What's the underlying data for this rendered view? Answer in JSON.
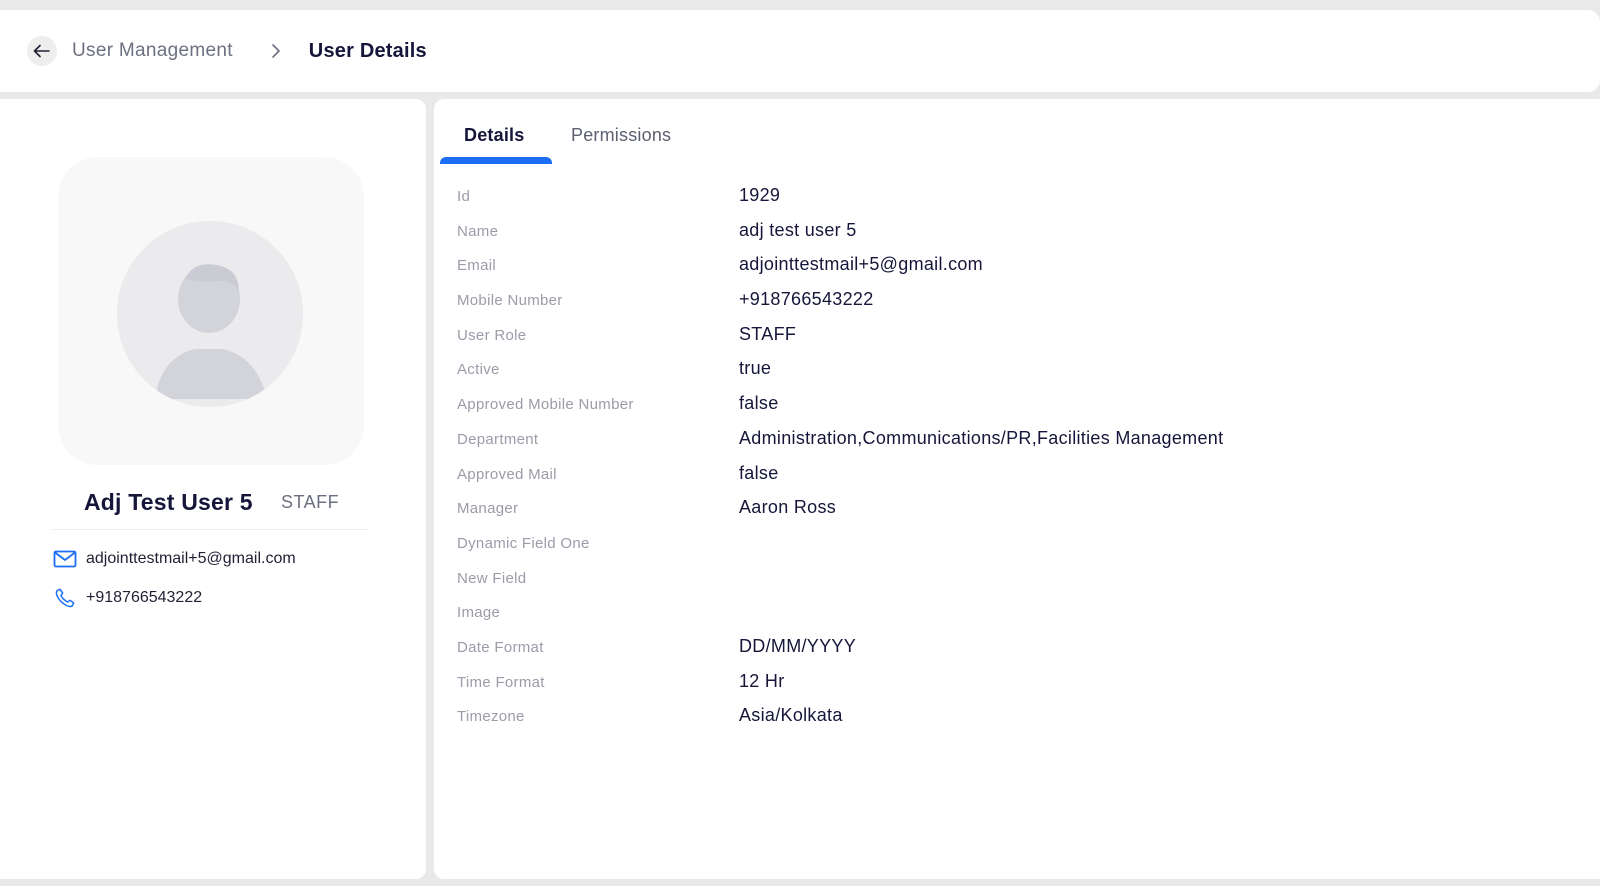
{
  "header": {
    "back_icon": "arrow-left-icon",
    "breadcrumb_parent": "User Management",
    "breadcrumb_separator_icon": "chevron-right-icon",
    "breadcrumb_current": "User Details"
  },
  "profile": {
    "avatar_icon": "user-placeholder-icon",
    "name": "Adj Test User 5",
    "role": "STAFF",
    "email_icon": "mail-icon",
    "email": "adjointtestmail+5@gmail.com",
    "phone_icon": "phone-icon",
    "phone": "+918766543222"
  },
  "tabs": [
    {
      "label": "Details",
      "active": true
    },
    {
      "label": "Permissions",
      "active": false
    }
  ],
  "details": [
    {
      "label": "Id",
      "value": "1929"
    },
    {
      "label": "Name",
      "value": "adj test user 5"
    },
    {
      "label": "Email",
      "value": "adjointtestmail+5@gmail.com"
    },
    {
      "label": "Mobile Number",
      "value": "+918766543222"
    },
    {
      "label": "User Role",
      "value": "STAFF"
    },
    {
      "label": "Active",
      "value": "true"
    },
    {
      "label": "Approved Mobile Number",
      "value": "false"
    },
    {
      "label": "Department",
      "value": "Administration,Communications/PR,Facilities Management"
    },
    {
      "label": "Approved Mail",
      "value": "false"
    },
    {
      "label": "Manager",
      "value": "Aaron Ross"
    },
    {
      "label": "Dynamic Field One",
      "value": ""
    },
    {
      "label": "New Field",
      "value": ""
    },
    {
      "label": "Image",
      "value": ""
    },
    {
      "label": "Date Format",
      "value": "DD/MM/YYYY"
    },
    {
      "label": "Time Format",
      "value": "12 Hr"
    },
    {
      "label": "Timezone",
      "value": "Asia/Kolkata"
    }
  ],
  "colors": {
    "accent": "#1b6ef3",
    "text_primary": "#16163a",
    "text_muted": "#9a9ca8",
    "background": "#e9e9e9"
  }
}
